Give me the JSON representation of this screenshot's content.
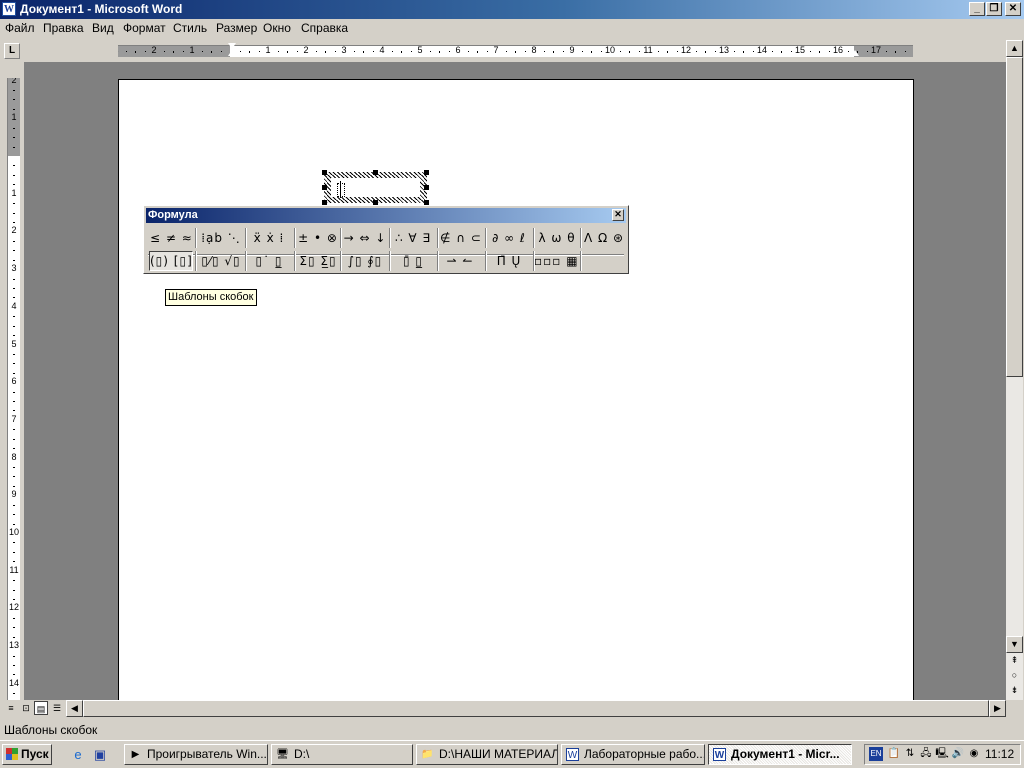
{
  "window": {
    "title": "Документ1 - Microsoft Word",
    "app_icon_letter": "W",
    "buttons": {
      "minimize": "_",
      "restore": "❐",
      "close": "✕"
    }
  },
  "menu": [
    "Файл",
    "Правка",
    "Вид",
    "Формат",
    "Стиль",
    "Размер",
    "Окно",
    "Справка"
  ],
  "ruler": {
    "tab_selector": "L",
    "horizontal_numbers": [
      "3",
      "2",
      "1",
      "1",
      "2",
      "3",
      "4",
      "5",
      "6",
      "7",
      "8",
      "9",
      "10",
      "11",
      "12",
      "13",
      "14",
      "15",
      "16",
      "17"
    ],
    "vertical_numbers": [
      "2",
      "1",
      "1",
      "2",
      "3",
      "4",
      "5",
      "6",
      "7",
      "8",
      "9",
      "10",
      "11",
      "12",
      "13",
      "14"
    ]
  },
  "formula_toolbar": {
    "title": "Формула",
    "close": "✕",
    "row1": [
      {
        "name": "relations-palette",
        "symbols": "≤ ≠ ≈"
      },
      {
        "name": "spaces-ellipses-palette",
        "symbols": "⁞ạb ⋱"
      },
      {
        "name": "embellishments-palette",
        "symbols": "ẍ ẋ ⁞"
      },
      {
        "name": "operators-palette",
        "symbols": "± • ⊗"
      },
      {
        "name": "arrows-palette",
        "symbols": "→ ⇔ ↓"
      },
      {
        "name": "logic-palette",
        "symbols": "∴ ∀ ∃"
      },
      {
        "name": "set-theory-palette",
        "symbols": "∉ ∩ ⊂"
      },
      {
        "name": "misc-symbols-palette",
        "symbols": "∂ ∞ ℓ"
      },
      {
        "name": "greek-lowercase-palette",
        "symbols": "λ ω θ"
      },
      {
        "name": "greek-uppercase-palette",
        "symbols": "Λ Ω ⊛"
      }
    ],
    "row2": [
      {
        "name": "fence-templates",
        "symbols": "(▯) [▯]",
        "pressed": true
      },
      {
        "name": "fraction-radical-templates",
        "symbols": "▯⁄▯ √▯"
      },
      {
        "name": "subscript-superscript-templates",
        "symbols": "▯˙ ▯̲"
      },
      {
        "name": "summation-templates",
        "symbols": "Σ▯ Σ̲▯"
      },
      {
        "name": "integral-templates",
        "symbols": "∫▯ ∮▯"
      },
      {
        "name": "underbar-overbar-templates",
        "symbols": "▯̄ ▯̲"
      },
      {
        "name": "labeled-arrow-templates",
        "symbols": "⇀ ↼"
      },
      {
        "name": "products-set-theory-templates",
        "symbols": "Π̄ Ų"
      },
      {
        "name": "matrix-templates",
        "symbols": "▫▫▫ ▦"
      }
    ]
  },
  "tooltip": "Шаблоны скобок",
  "status_bar": "Шаблоны скобок",
  "taskbar": {
    "start_label": "Пуск",
    "quick_launch": [
      "ie-icon",
      "show-desktop-icon"
    ],
    "tasks": [
      {
        "label": "Проигрыватель Win...",
        "icon": "▶",
        "active": false
      },
      {
        "label": "D:\\",
        "icon": "🖥",
        "active": false
      },
      {
        "label": "D:\\НАШИ МАТЕРИАЛ...",
        "icon": "📁",
        "active": false
      },
      {
        "label": "Лабораторные рабо...",
        "icon": "W",
        "active": false
      },
      {
        "label": "Документ1 - Micr...",
        "icon": "W",
        "active": true
      }
    ],
    "language": "EN",
    "clock": "11:12"
  }
}
